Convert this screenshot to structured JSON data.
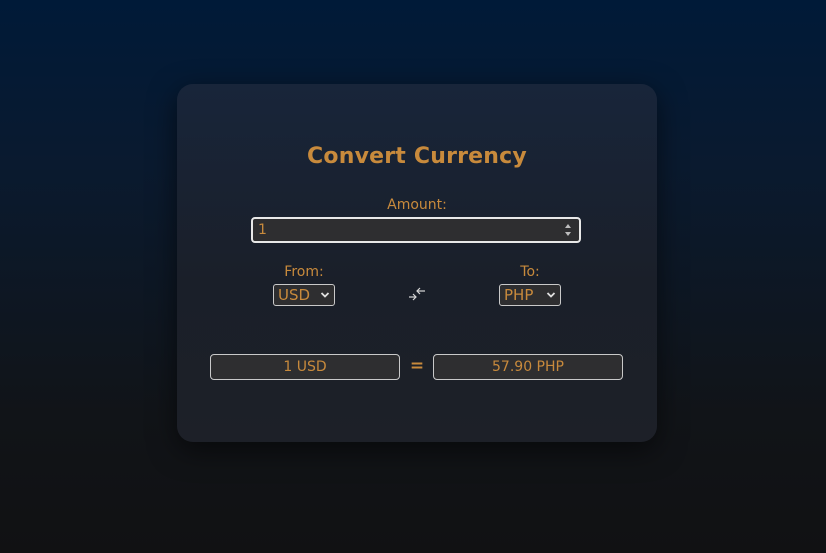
{
  "converter": {
    "title": "Convert Currency",
    "amount_label": "Amount:",
    "amount_value": "1",
    "from_label": "From:",
    "from_currency": "USD",
    "to_label": "To:",
    "to_currency": "PHP",
    "swap_icon": "swap-arrows-icon",
    "result_from": "1 USD",
    "equals": "=",
    "result_to": "57.90 PHP"
  },
  "colors": {
    "accent": "#c88a3c",
    "card_bg": "#1a1f29",
    "field_bg": "#2e2e30",
    "page_bg_top": "#001a38",
    "page_bg_bottom": "#111113"
  }
}
